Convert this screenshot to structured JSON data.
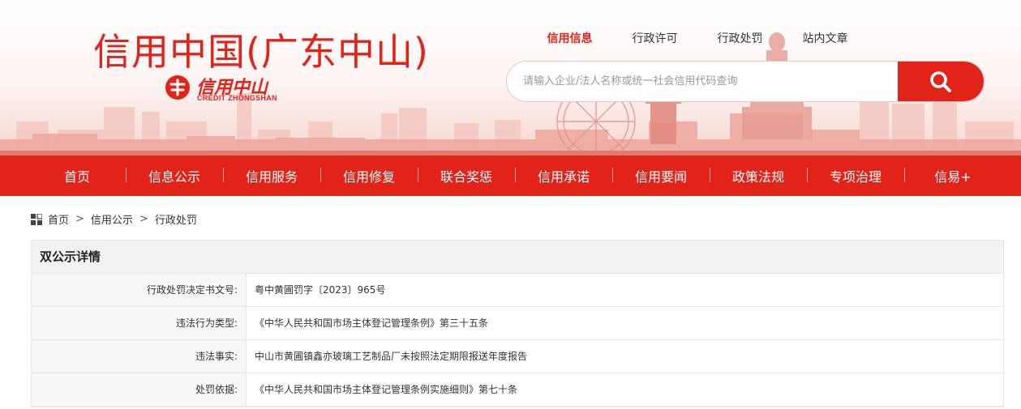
{
  "header": {
    "site_title": "信用中国(广东中山)",
    "logo_cn": "信用中山",
    "logo_en": "CREDIT ZHONGSHAN",
    "top_links": [
      "信用信息",
      "行政许可",
      "行政处罚",
      "站内文章"
    ],
    "active_top_link": "信用信息",
    "search": {
      "placeholder": "请输入企业/法人名称或统一社会信用代码查询",
      "value": "",
      "button_icon": "search-icon"
    }
  },
  "nav": {
    "items": [
      "首页",
      "信息公示",
      "信用服务",
      "信用修复",
      "联合奖惩",
      "信用承诺",
      "信用要闻",
      "政策法规",
      "专项治理",
      "信易+"
    ]
  },
  "breadcrumb": {
    "icon": "grid-icon",
    "items": [
      "首页",
      "信用公示",
      "行政处罚"
    ],
    "separator": ">"
  },
  "detail": {
    "title": "双公示详情",
    "rows": [
      {
        "label": "行政处罚决定书文号:",
        "value": "粤中黄圃罚字〔2023〕965号"
      },
      {
        "label": "违法行为类型:",
        "value": "《中华人民共和国市场主体登记管理条例》第三十五条"
      },
      {
        "label": "违法事实:",
        "value": "中山市黄圃镇鑫亦玻璃工艺制品厂未按照法定期限报送年度报告"
      },
      {
        "label": "处罚依据:",
        "value": "《中华人民共和国市场主体登记管理条例实施细则》第七十条"
      }
    ]
  },
  "colors": {
    "brand_red": "#e2231a",
    "panel_head_bg": "#f2f2f2",
    "label_bg": "#f7f7f7",
    "border": "#e6e6e6"
  }
}
